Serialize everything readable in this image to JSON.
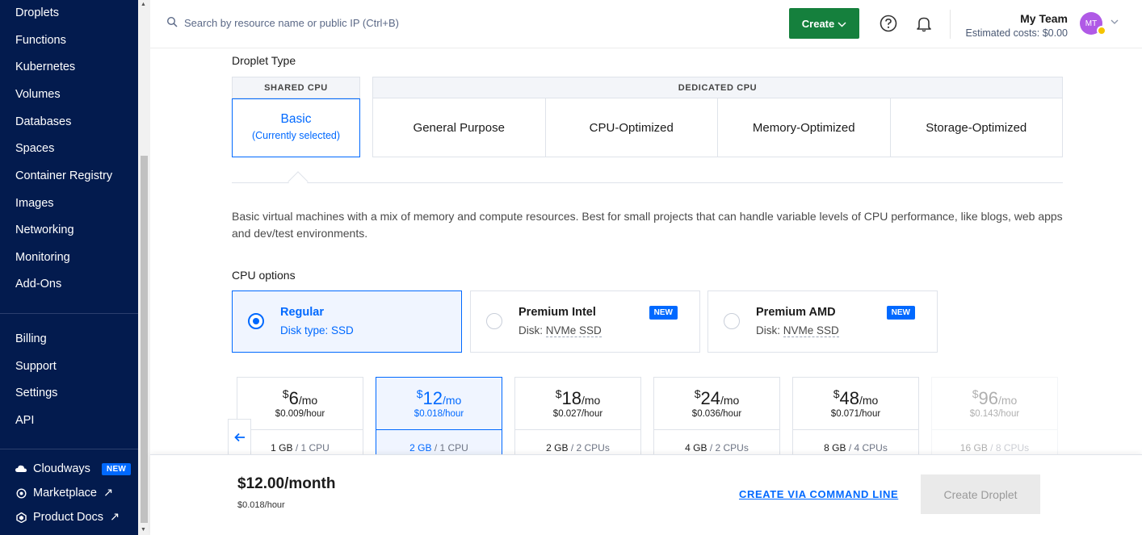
{
  "sidebar": {
    "items": [
      {
        "label": "Droplets"
      },
      {
        "label": "Functions"
      },
      {
        "label": "Kubernetes"
      },
      {
        "label": "Volumes"
      },
      {
        "label": "Databases"
      },
      {
        "label": "Spaces"
      },
      {
        "label": "Container Registry"
      },
      {
        "label": "Images"
      },
      {
        "label": "Networking"
      },
      {
        "label": "Monitoring"
      },
      {
        "label": "Add-Ons"
      }
    ],
    "account_items": [
      {
        "label": "Billing"
      },
      {
        "label": "Support"
      },
      {
        "label": "Settings"
      },
      {
        "label": "API"
      }
    ],
    "external": {
      "cloudways": {
        "label": "Cloudways",
        "badge": "NEW",
        "icon": "cloud-icon"
      },
      "marketplace": {
        "label": "Marketplace",
        "arrow": "↗",
        "icon": "marketplace-icon"
      },
      "docs": {
        "label": "Product Docs",
        "arrow": "↗",
        "icon": "docs-icon"
      }
    },
    "bg_color": "#031b4e"
  },
  "header": {
    "search_placeholder": "Search by resource name or public IP (Ctrl+B)",
    "create_label": "Create",
    "team_name": "My Team",
    "estimated_costs": "Estimated costs: $0.00",
    "avatar_initials": "MT",
    "create_color": "#15803d"
  },
  "droplet_type": {
    "title": "Droplet Type",
    "shared_header": "SHARED CPU",
    "dedicated_header": "DEDICATED CPU",
    "basic_label": "Basic",
    "basic_sub": "(Currently selected)",
    "dedicated_options": [
      "General Purpose",
      "CPU-Optimized",
      "Memory-Optimized",
      "Storage-Optimized"
    ]
  },
  "description": "Basic virtual machines with a mix of memory and compute resources. Best for small projects that can handle variable levels of CPU performance, like blogs, web apps and dev/test environments.",
  "cpu_options": {
    "title": "CPU options",
    "regular": {
      "title": "Regular",
      "sub": "Disk type: SSD"
    },
    "intel": {
      "title": "Premium Intel",
      "sub_label": "Disk: ",
      "sub_value": "NVMe SSD",
      "badge": "NEW"
    },
    "amd": {
      "title": "Premium AMD",
      "sub_label": "Disk: ",
      "sub_value": "NVMe SSD",
      "badge": "NEW"
    }
  },
  "plans": [
    {
      "dollar": "$",
      "price": "6",
      "per": "/mo",
      "hourly": "$0.009/hour",
      "mem": "1 GB",
      "cpu": " / 1 CPU"
    },
    {
      "dollar": "$",
      "price": "12",
      "per": "/mo",
      "hourly": "$0.018/hour",
      "mem": "2 GB",
      "cpu": " / 1 CPU"
    },
    {
      "dollar": "$",
      "price": "18",
      "per": "/mo",
      "hourly": "$0.027/hour",
      "mem": "2 GB",
      "cpu": " / 2 CPUs"
    },
    {
      "dollar": "$",
      "price": "24",
      "per": "/mo",
      "hourly": "$0.036/hour",
      "mem": "4 GB",
      "cpu": " / 2 CPUs"
    },
    {
      "dollar": "$",
      "price": "48",
      "per": "/mo",
      "hourly": "$0.071/hour",
      "mem": "8 GB",
      "cpu": " / 4 CPUs"
    },
    {
      "dollar": "$",
      "price": "96",
      "per": "/mo",
      "hourly": "$0.143/hour",
      "mem": "16 GB",
      "cpu": " / 8 CPUs"
    }
  ],
  "footer": {
    "total": "$12.00/month",
    "hourly": "$0.018/hour",
    "cli_link": "CREATE VIA COMMAND LINE",
    "create_button": "Create Droplet"
  },
  "accent_color": "#0069ff"
}
